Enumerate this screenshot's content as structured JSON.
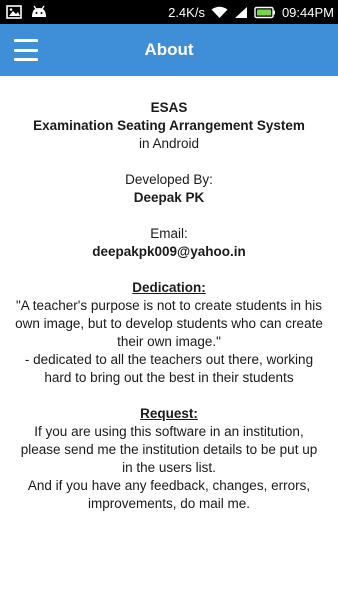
{
  "status_bar": {
    "network_speed": "2.4K/s",
    "time": "09:44PM",
    "icons": [
      "image-icon",
      "android-icon",
      "signal-icon",
      "wifi-icon",
      "battery-icon"
    ]
  },
  "app_bar": {
    "title": "About",
    "menu_icon": "hamburger-menu-icon",
    "background_color": "#3f8fd8"
  },
  "about": {
    "app_short_name": "ESAS",
    "app_full_name": "Examination Seating Arrangement System",
    "platform": "in Android",
    "developed_by_label": "Developed By:",
    "developer_name": "Deepak PK",
    "email_label": "Email:",
    "email": "deepakpk009@yahoo.in",
    "dedication_heading": "Dedication:",
    "dedication_quote": "\"A teacher's purpose is not to create students in his own image, but to develop students who can create their own image.\"",
    "dedication_note": "- dedicated to all the teachers out there, working hard to bring out the best in their students",
    "request_heading": "Request:",
    "request_text_1": "If you are using this software in an institution, please send me the institution details to be put up in the users list.",
    "request_text_2": "And if you have any feedback, changes, errors, improvements, do mail me."
  }
}
